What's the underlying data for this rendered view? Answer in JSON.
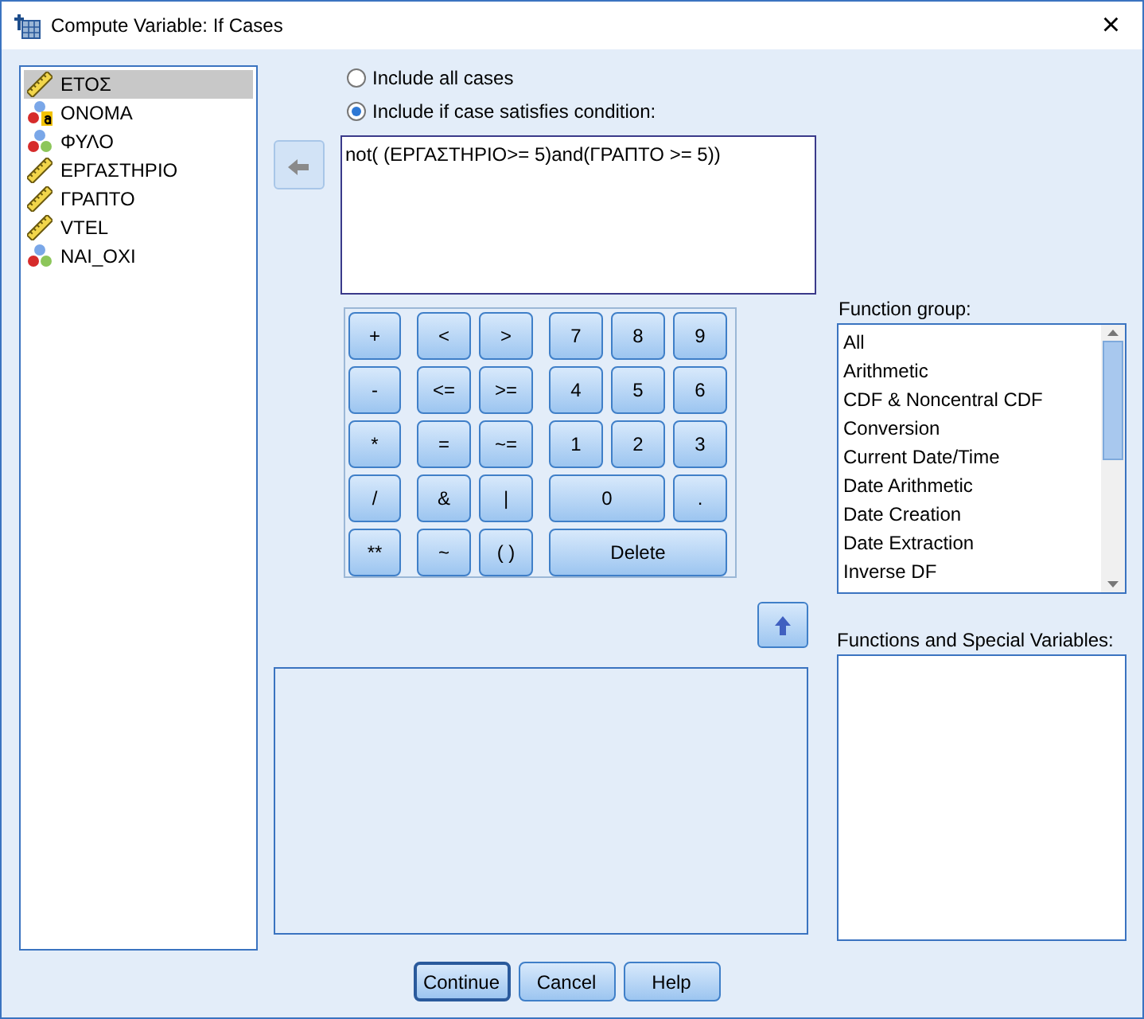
{
  "window": {
    "title": "Compute Variable: If Cases",
    "close": "×"
  },
  "variables": [
    {
      "name": "ΕΤΟΣ",
      "kind": "scale",
      "selected": true
    },
    {
      "name": "ΟΝΟΜΑ",
      "kind": "string",
      "selected": false
    },
    {
      "name": "ΦΥΛΟ",
      "kind": "nominal",
      "selected": false
    },
    {
      "name": "ΕΡΓΑΣΤΗΡΙΟ",
      "kind": "scale",
      "selected": false
    },
    {
      "name": "ΓΡΑΠΤΟ",
      "kind": "scale",
      "selected": false
    },
    {
      "name": "VTEL",
      "kind": "scale",
      "selected": false
    },
    {
      "name": "ΝΑΙ_ΟΧΙ",
      "kind": "nominal",
      "selected": false
    }
  ],
  "options": [
    {
      "label": "Include all cases",
      "selected": false
    },
    {
      "label": "Include if case satisfies condition:",
      "selected": true
    }
  ],
  "condition": "not( (ΕΡΓΑΣΤΗΡΙΟ>= 5)and(ΓΡΑΠΤΟ >= 5))",
  "keypad": [
    {
      "label": "+",
      "kind": "single"
    },
    {
      "label": "<",
      "kind": "single"
    },
    {
      "label": ">",
      "kind": "single"
    },
    {
      "label": "7",
      "kind": "single"
    },
    {
      "label": "8",
      "kind": "single"
    },
    {
      "label": "9",
      "kind": "single"
    },
    {
      "label": "-",
      "kind": "single"
    },
    {
      "label": "<=",
      "kind": "single"
    },
    {
      "label": ">=",
      "kind": "single"
    },
    {
      "label": "4",
      "kind": "single"
    },
    {
      "label": "5",
      "kind": "single"
    },
    {
      "label": "6",
      "kind": "single"
    },
    {
      "label": "*",
      "kind": "single"
    },
    {
      "label": "=",
      "kind": "single"
    },
    {
      "label": "~=",
      "kind": "single"
    },
    {
      "label": "1",
      "kind": "single"
    },
    {
      "label": "2",
      "kind": "single"
    },
    {
      "label": "3",
      "kind": "single"
    },
    {
      "label": "/",
      "kind": "single"
    },
    {
      "label": "&",
      "kind": "single"
    },
    {
      "label": "|",
      "kind": "single"
    },
    {
      "label": "0",
      "kind": "double"
    },
    {
      "label": ".",
      "kind": "single"
    },
    {
      "label": "**",
      "kind": "single"
    },
    {
      "label": "~",
      "kind": "single"
    },
    {
      "label": "( )",
      "kind": "single"
    },
    {
      "label": "Delete",
      "kind": "triple"
    }
  ],
  "function_group": {
    "label": "Function group:",
    "items": [
      "All",
      "Arithmetic",
      "CDF & Noncentral CDF",
      "Conversion",
      "Current Date/Time",
      "Date Arithmetic",
      "Date Creation",
      "Date Extraction",
      "Inverse DF"
    ]
  },
  "functions": {
    "label": "Functions and Special Variables:"
  },
  "buttons": [
    {
      "label": "Continue",
      "default": true
    },
    {
      "label": "Cancel",
      "default": false
    },
    {
      "label": "Help",
      "default": false
    }
  ]
}
